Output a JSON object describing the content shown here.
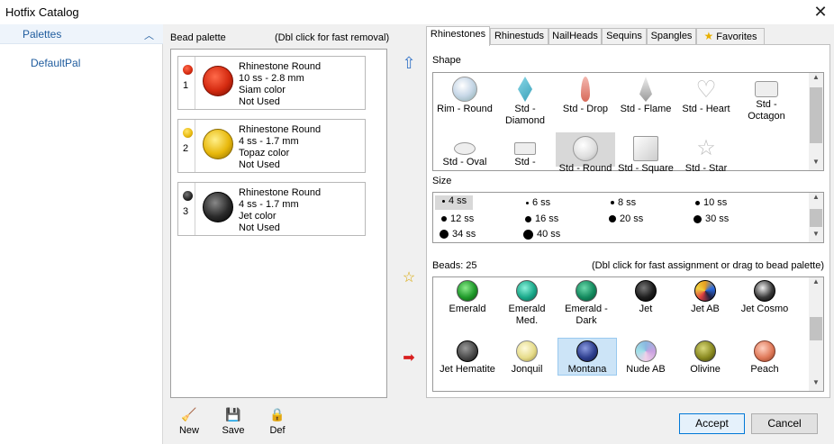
{
  "window": {
    "title": "Hotfix Catalog",
    "close_glyph": "✕"
  },
  "sidebar": {
    "header": "Palettes",
    "items": [
      "DefaultPal"
    ]
  },
  "bead_palette": {
    "label": "Bead palette",
    "hint": "(Dbl click for fast removal)",
    "cards": [
      {
        "index": "1",
        "name": "Rhinestone Round",
        "size": "10 ss -  2.8 mm",
        "color_name": "Siam color",
        "status": "Not Used",
        "color": "#d42a10"
      },
      {
        "index": "2",
        "name": "Rhinestone Round",
        "size": "4 ss -  1.7 mm",
        "color_name": "Topaz color",
        "status": "Not Used",
        "color": "#e8b80c"
      },
      {
        "index": "3",
        "name": "Rhinestone Round",
        "size": "4 ss -  1.7 mm",
        "color_name": "Jet color",
        "status": "Not Used",
        "color": "#2a2a2a"
      }
    ]
  },
  "tabs": [
    "Rhinestones",
    "Rhinestuds",
    "NailHeads",
    "Sequins",
    "Spangles",
    "Favorites"
  ],
  "shape": {
    "label": "Shape",
    "items": [
      "Rim - Round",
      "Std - Diamond",
      "Std - Drop",
      "Std - Flame",
      "Std - Heart",
      "Std - Octagon",
      "Std - Oval",
      "Std -",
      "Std - Round",
      "Std - Square",
      "Std - Star"
    ],
    "selected": "Std - Round"
  },
  "size": {
    "label": "Size",
    "items": [
      "4 ss",
      "6 ss",
      "8 ss",
      "10 ss",
      "12 ss",
      "16 ss",
      "20 ss",
      "30 ss",
      "34 ss",
      "40 ss"
    ],
    "selected": "4 ss"
  },
  "beads": {
    "label": "Beads: 25",
    "hint": "(Dbl click for fast assignment or drag to bead palette)",
    "items": [
      {
        "name": "Emerald",
        "color": "#1f9a2a"
      },
      {
        "name": "Emerald Med.",
        "color": "#1aa98a"
      },
      {
        "name": "Emerald - Dark",
        "color": "#138a5e"
      },
      {
        "name": "Jet",
        "color": "#1e1e1e"
      },
      {
        "name": "Jet AB",
        "color": "#3a3a8a"
      },
      {
        "name": "Jet Cosmo",
        "color": "#3a3a3a"
      },
      {
        "name": "Jet Hematite",
        "color": "#4a4a4a"
      },
      {
        "name": "Jonquil",
        "color": "#e6dc8a"
      },
      {
        "name": "Montana",
        "color": "#2e3f8e"
      },
      {
        "name": "Nude AB",
        "color": "#8ab8e0"
      },
      {
        "name": "Olivine",
        "color": "#8a8a20"
      },
      {
        "name": "Peach",
        "color": "#e07a5a"
      }
    ],
    "selected": "Montana"
  },
  "toolbar": {
    "new_label": "New",
    "save_label": "Save",
    "def_label": "Def"
  },
  "buttons": {
    "accept": "Accept",
    "cancel": "Cancel"
  }
}
